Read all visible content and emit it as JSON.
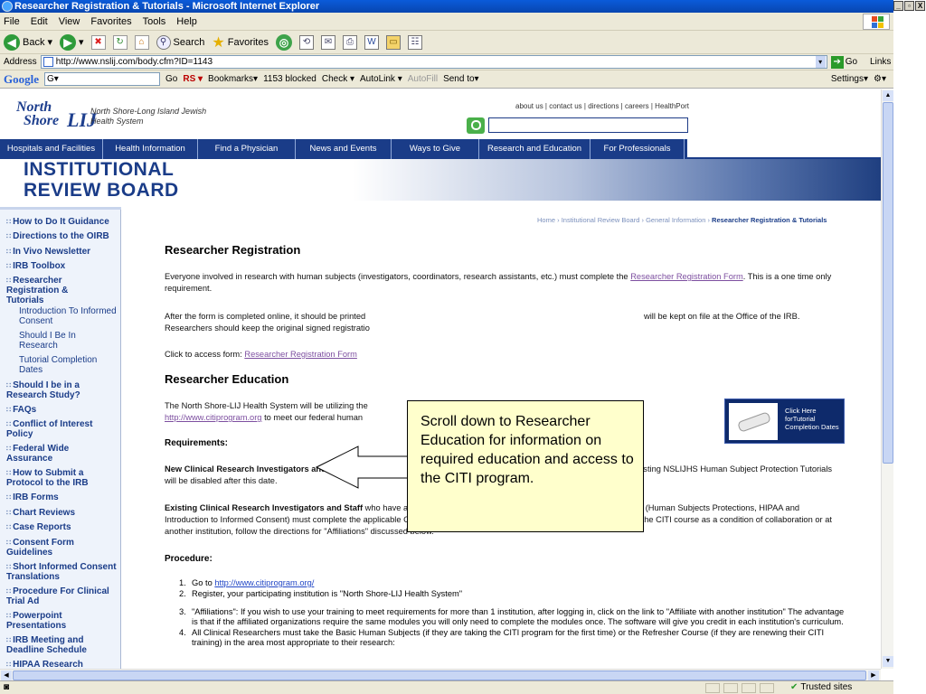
{
  "window": {
    "title": "Researcher Registration & Tutorials - Microsoft Internet Explorer",
    "buttons": [
      "_",
      "▫",
      "X"
    ]
  },
  "menu": [
    "File",
    "Edit",
    "View",
    "Favorites",
    "Tools",
    "Help"
  ],
  "toolbar": {
    "back": "Back",
    "search": "Search",
    "favorites": "Favorites"
  },
  "address": {
    "label": "Address",
    "url": "http://www.nslij.com/body.cfm?ID=1143",
    "go": "Go",
    "links": "Links"
  },
  "googlebar": {
    "logo": "Google",
    "combo": "G▾",
    "go": "Go",
    "bookmarks": "Bookmarks▾",
    "blocked": "1153 blocked",
    "check": "Check ▾",
    "autolink": "AutoLink ▾",
    "autofill": "AutoFill",
    "sendto": "Send to▾",
    "settings": "Settings▾"
  },
  "header": {
    "logo_north": "North",
    "logo_shore": "Shore",
    "logo_lij": "LIJ",
    "org_line1": "North Shore-Long Island Jewish",
    "org_line2": "Health System",
    "top_links": "about us | contact us | directions | careers | HealthPort"
  },
  "nav": [
    "Hospitals and Facilities",
    "Health Information",
    "Find a Physician",
    "News and Events",
    "Ways to Give",
    "Research and Education",
    "For Professionals"
  ],
  "banner": {
    "line1": "INSTITUTIONAL",
    "line2": "REVIEW BOARD"
  },
  "sidebar": {
    "items": [
      "How to Do It Guidance",
      "Directions to the OIRB",
      "In Vivo Newsletter",
      "IRB Toolbox",
      "Researcher Registration & Tutorials",
      "Should I be in a Research Study?",
      "FAQs",
      "Conflict of Interest Policy",
      "Federal Wide Assurance",
      "How to Submit a Protocol to the IRB",
      "IRB Forms",
      "Chart Reviews",
      "Case Reports",
      "Consent Form Guidelines",
      "Short Informed Consent Translations",
      "Procedure For Clinical Trial Ad",
      "Powerpoint Presentations",
      "IRB Meeting and Deadline Schedule",
      "HIPAA Research"
    ],
    "subitems": [
      "Introduction To Informed Consent",
      "Should I Be In Research",
      "Tutorial Completion Dates"
    ]
  },
  "breadcrumb": {
    "home": "Home",
    "irb": "Institutional Review Board",
    "general": "General Information",
    "current": "Researcher Registration & Tutorials"
  },
  "registration": {
    "heading": "Researcher Registration",
    "p1": "Everyone involved in research with human subjects (investigators, coordinators, research assistants, etc.) must complete the",
    "p1_link": "Researcher Registration Form",
    "p1_end": ". This is a one time only requirement.",
    "p2a": "After the form is completed online, it should be printed",
    "p2b": "will be kept on file at the Office of the IRB.",
    "p2c": "Researchers should keep the original signed registratio",
    "p3": "Click to access form:",
    "p3_link": "Researcher Registration Form"
  },
  "education": {
    "heading": "Researcher Education",
    "p1": "The North Shore-LIJ Health System will be utilizing the",
    "p1_link": "http://www.citiprogram.org",
    "p1_end": "to meet our federal human",
    "badge": "Click Here forTutorial Completion Dates"
  },
  "requirements": {
    "label": "Requirements:",
    "new_bold": "New Clinical Research Investigators and Staff",
    "new_text": " – As of February 1, 2008 will be required to take the CITI program only.  The existing NSLIJHS Human Subject Protection Tutorials will be disabled after this date.",
    "exist_bold": "Existing Clinical Research Investigators and Staff",
    "exist_text": " who have already completed NSLIJHS Human Subject Protection Tutorials (Human Subjects Protections, HIPAA and Introduction to Informed Consent) must complete the applicable CITI modules by December 31, 2008.  If you have already taken the CITI course as a condition of collaboration or at another institution, follow the directions for \"Affiliations\" discussed below."
  },
  "procedure": {
    "label": "Procedure:",
    "step1_pre": "Go to",
    "step1_link": "http://www.citiprogram.org/",
    "step2": "Register, your participating institution is \"North Shore-LIJ Health System\"",
    "step3": "\"Affiliations\": If you wish to use your training to meet requirements for more than 1 institution, after logging in, click on the link to \"Affiliate with another institution\" The advantage is that if the affiliated organizations require the same modules you will only need to complete the modules once.   The software will give you credit in each institution's curriculum.",
    "step4": "All Clinical Researchers must take the Basic Human Subjects (if they are taking the CITI program for the first time) or the Refresher Course (if they are renewing their CITI training) in the area most appropriate to their research:"
  },
  "callout": {
    "text": "Scroll down to Researcher Education for information on required education and access to the CITI program."
  },
  "status": {
    "zone": "Trusted sites"
  }
}
